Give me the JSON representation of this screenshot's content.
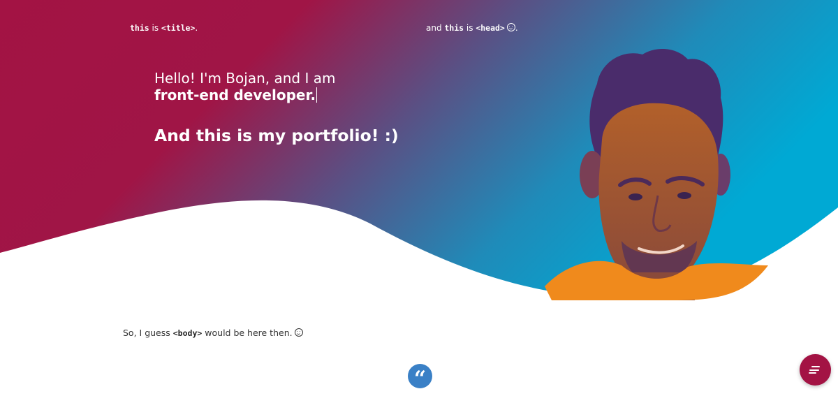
{
  "header": {
    "left_note": {
      "keyword": "this",
      "middle": " is ",
      "tag": "<title>",
      "end": "."
    },
    "right_note": {
      "prefix": "and ",
      "keyword": "this",
      "middle": " is ",
      "tag": "<head>",
      "end": "."
    }
  },
  "hero": {
    "greeting": "Hello! I'm Bojan, and I am",
    "role": "front-end developer.",
    "headline": "And this is my portfolio! :)"
  },
  "body_note": {
    "prefix": "So, I guess ",
    "tag": "<body>",
    "suffix": " would be here then."
  },
  "quote_badge": {
    "glyph": "“"
  },
  "menu_button": {
    "icon": "menu-icon"
  },
  "colors": {
    "gradient_start": "#a31344",
    "gradient_end": "#00a9d4",
    "accent": "#a31344",
    "quote_badge": "#3a80c6",
    "shirt": "#f08a1c"
  }
}
